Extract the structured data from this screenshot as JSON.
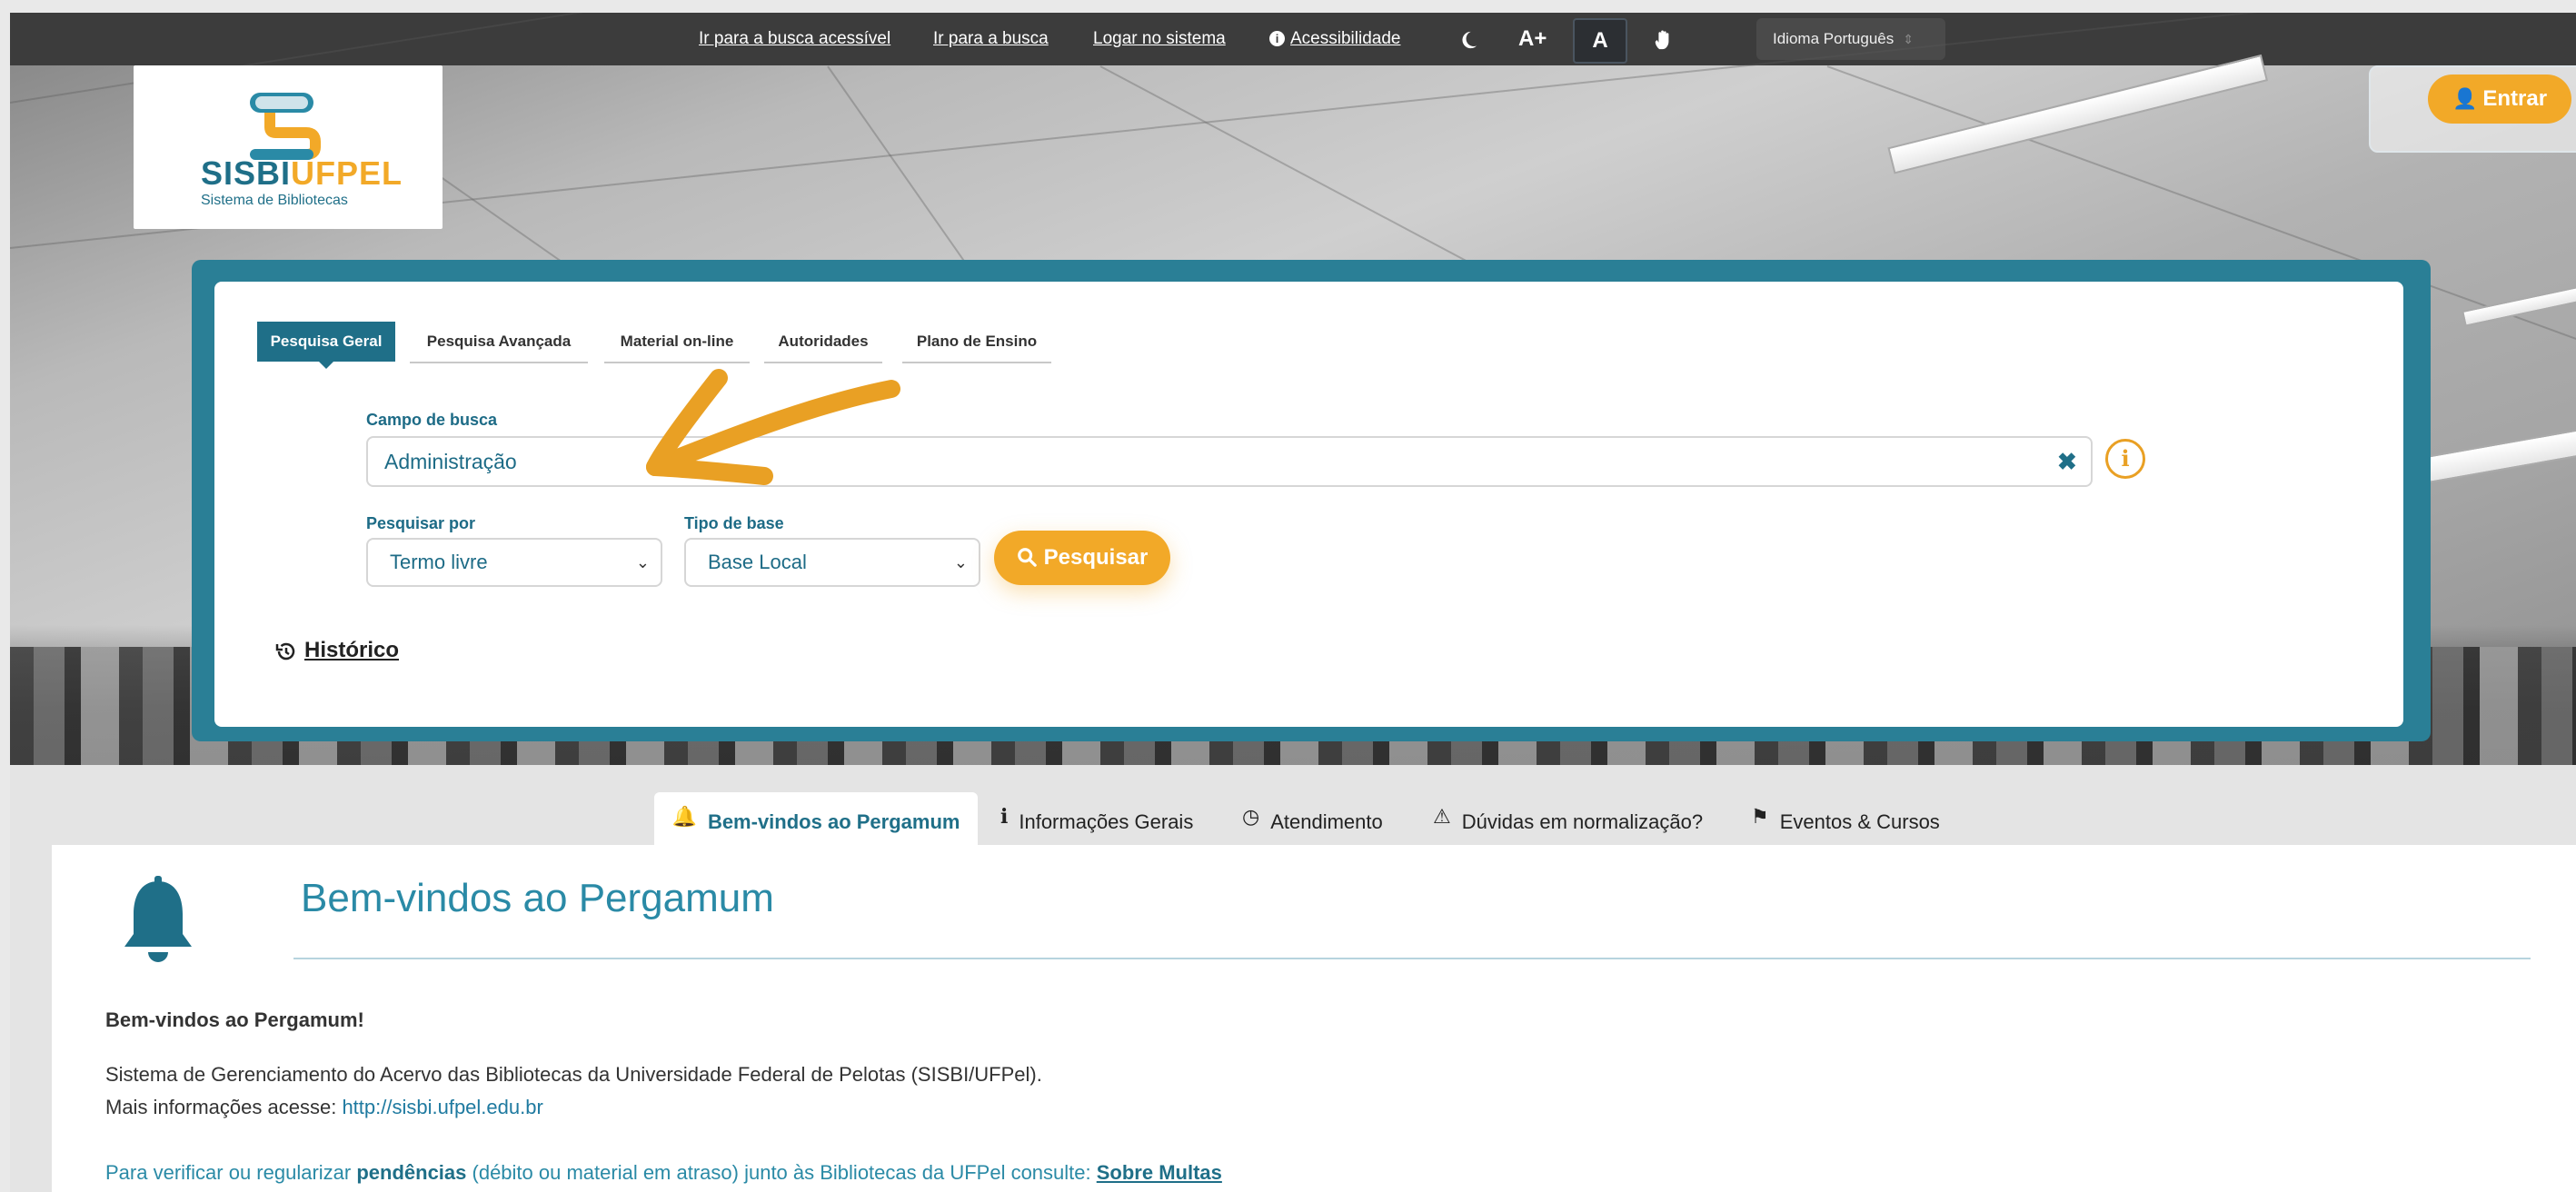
{
  "topbar": {
    "links": [
      "Ir para a busca acessível",
      "Ir para a busca",
      "Logar no sistema"
    ],
    "accessibility_label": "Acessibilidade",
    "accessibility_icon": "info-circle-icon",
    "dark_mode_icon": "moon-icon",
    "font_increase": "A+",
    "contrast_label": "A",
    "sign_language_icon": "hand-icon",
    "language_select": "Idioma Português"
  },
  "logo": {
    "title_part1": "SISBI",
    "title_part2": "UFPEL",
    "subtitle": "Sistema de Bibliotecas",
    "primary_color": "#1f6f88",
    "accent_color": "#f2a928"
  },
  "login": {
    "label": "Entrar",
    "icon": "user-lock-icon"
  },
  "search": {
    "tabs": [
      "Pesquisa Geral",
      "Pesquisa Avançada",
      "Material on-line",
      "Autoridades",
      "Plano de Ensino"
    ],
    "active_tab": "Pesquisa Geral",
    "field_label": "Campo de busca",
    "field_value": "Administração",
    "search_by_label": "Pesquisar por",
    "search_by_value": "Termo livre",
    "base_type_label": "Tipo de base",
    "base_type_value": "Base Local",
    "submit_label": "Pesquisar",
    "history_label": "Histórico"
  },
  "info_tabs": [
    {
      "label": "Bem-vindos ao Pergamum",
      "icon": "bell-icon",
      "active": true
    },
    {
      "label": "Informações Gerais",
      "icon": "info-icon",
      "active": false
    },
    {
      "label": "Atendimento",
      "icon": "clock-icon",
      "active": false
    },
    {
      "label": "Dúvidas em normalização?",
      "icon": "warning-icon",
      "active": false
    },
    {
      "label": "Eventos & Cursos",
      "icon": "bookmark-icon",
      "active": false
    }
  ],
  "welcome": {
    "title": "Bem-vindos ao Pergamum",
    "heading": "Bem-vindos ao Pergamum!",
    "line1": "Sistema de Gerenciamento do Acervo das Bibliotecas da Universidade Federal de Pelotas (SISBI/UFPel).",
    "line2_prefix": "Mais informações acesse: ",
    "line2_link": "http://sisbi.ufpel.edu.br",
    "line3_prefix": "Para verificar ou regularizar ",
    "line3_bold": "pendências",
    "line3_middle": " (débito ou material em atraso) junto às Bibliotecas da UFPel consulte: ",
    "line3_link": "Sobre Multas"
  }
}
